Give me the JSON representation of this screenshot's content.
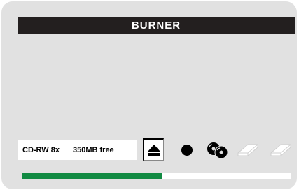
{
  "app": {
    "title": "BURNER"
  },
  "status": {
    "drive": "CD-RW 8x",
    "free_space": "350MB free"
  },
  "toolbar": {
    "icons": [
      "eject-icon",
      "record-icon",
      "discs-icon",
      "erase-icon",
      "erase-icon"
    ]
  },
  "progress": {
    "fraction": 0.52,
    "color": "#118a42"
  },
  "colors": {
    "panel": "#e1e1e1",
    "titlebar": "#231f1f",
    "disabled_icon": "#ffffff"
  }
}
